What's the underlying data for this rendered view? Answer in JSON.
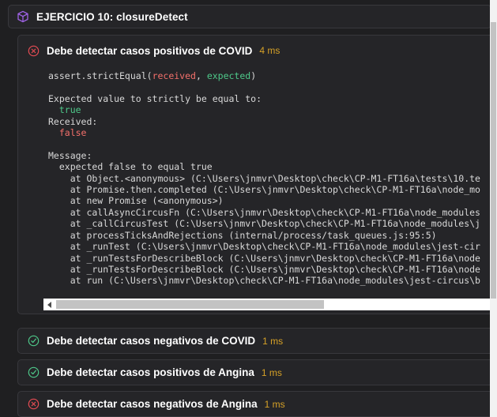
{
  "suite": {
    "icon": "cube-icon",
    "title": "EJERCICIO 10: closureDetect"
  },
  "failing_test": {
    "status": "failed",
    "status_icon": "circle-x-icon",
    "name": "Debe detectar casos positivos de COVID",
    "duration": "4 ms",
    "assertion": {
      "call_prefix": "assert.strictEqual(",
      "arg_received": "received",
      "arg_separator": ", ",
      "arg_expected": "expected",
      "call_suffix": ")"
    },
    "expected_label": "Expected value to strictly be equal to:",
    "expected_value": "true",
    "received_label": "Received:",
    "received_value": "false",
    "message_label": "Message:",
    "message_text": "expected false to equal true",
    "stack": [
      "    at Object.<anonymous> (C:\\Users\\jnmvr\\Desktop\\check\\CP-M1-FT16a\\tests\\10.te",
      "    at Promise.then.completed (C:\\Users\\jnmvr\\Desktop\\check\\CP-M1-FT16a\\node_mo",
      "    at new Promise (<anonymous>)",
      "    at callAsyncCircusFn (C:\\Users\\jnmvr\\Desktop\\check\\CP-M1-FT16a\\node_modules",
      "    at _callCircusTest (C:\\Users\\jnmvr\\Desktop\\check\\CP-M1-FT16a\\node_modules\\j",
      "    at processTicksAndRejections (internal/process/task_queues.js:95:5)",
      "    at _runTest (C:\\Users\\jnmvr\\Desktop\\check\\CP-M1-FT16a\\node_modules\\jest-cir",
      "    at _runTestsForDescribeBlock (C:\\Users\\jnmvr\\Desktop\\check\\CP-M1-FT16a\\node",
      "    at _runTestsForDescribeBlock (C:\\Users\\jnmvr\\Desktop\\check\\CP-M1-FT16a\\node",
      "    at run (C:\\Users\\jnmvr\\Desktop\\check\\CP-M1-FT16a\\node_modules\\jest-circus\\b"
    ]
  },
  "other_tests": [
    {
      "status": "passed",
      "status_icon": "circle-check-icon",
      "name": "Debe detectar casos negativos de COVID",
      "duration": "1 ms"
    },
    {
      "status": "passed",
      "status_icon": "circle-check-icon",
      "name": "Debe detectar casos positivos de Angina",
      "duration": "1 ms"
    },
    {
      "status": "failed",
      "status_icon": "circle-x-icon",
      "name": "Debe detectar casos negativos de Angina",
      "duration": "1 ms"
    }
  ],
  "colors": {
    "background": "#1f1f21",
    "panel": "#252528",
    "border": "#38383c",
    "accent_purple": "#a063e8",
    "pass_green": "#4ec98a",
    "fail_red": "#e84c54",
    "duration_yellow": "#d6a127",
    "code_text": "#d8d8d8"
  },
  "scrollbars": {
    "horizontal_left_arrow": "chevron-left-icon",
    "horizontal_right_arrow": "chevron-right-icon"
  }
}
